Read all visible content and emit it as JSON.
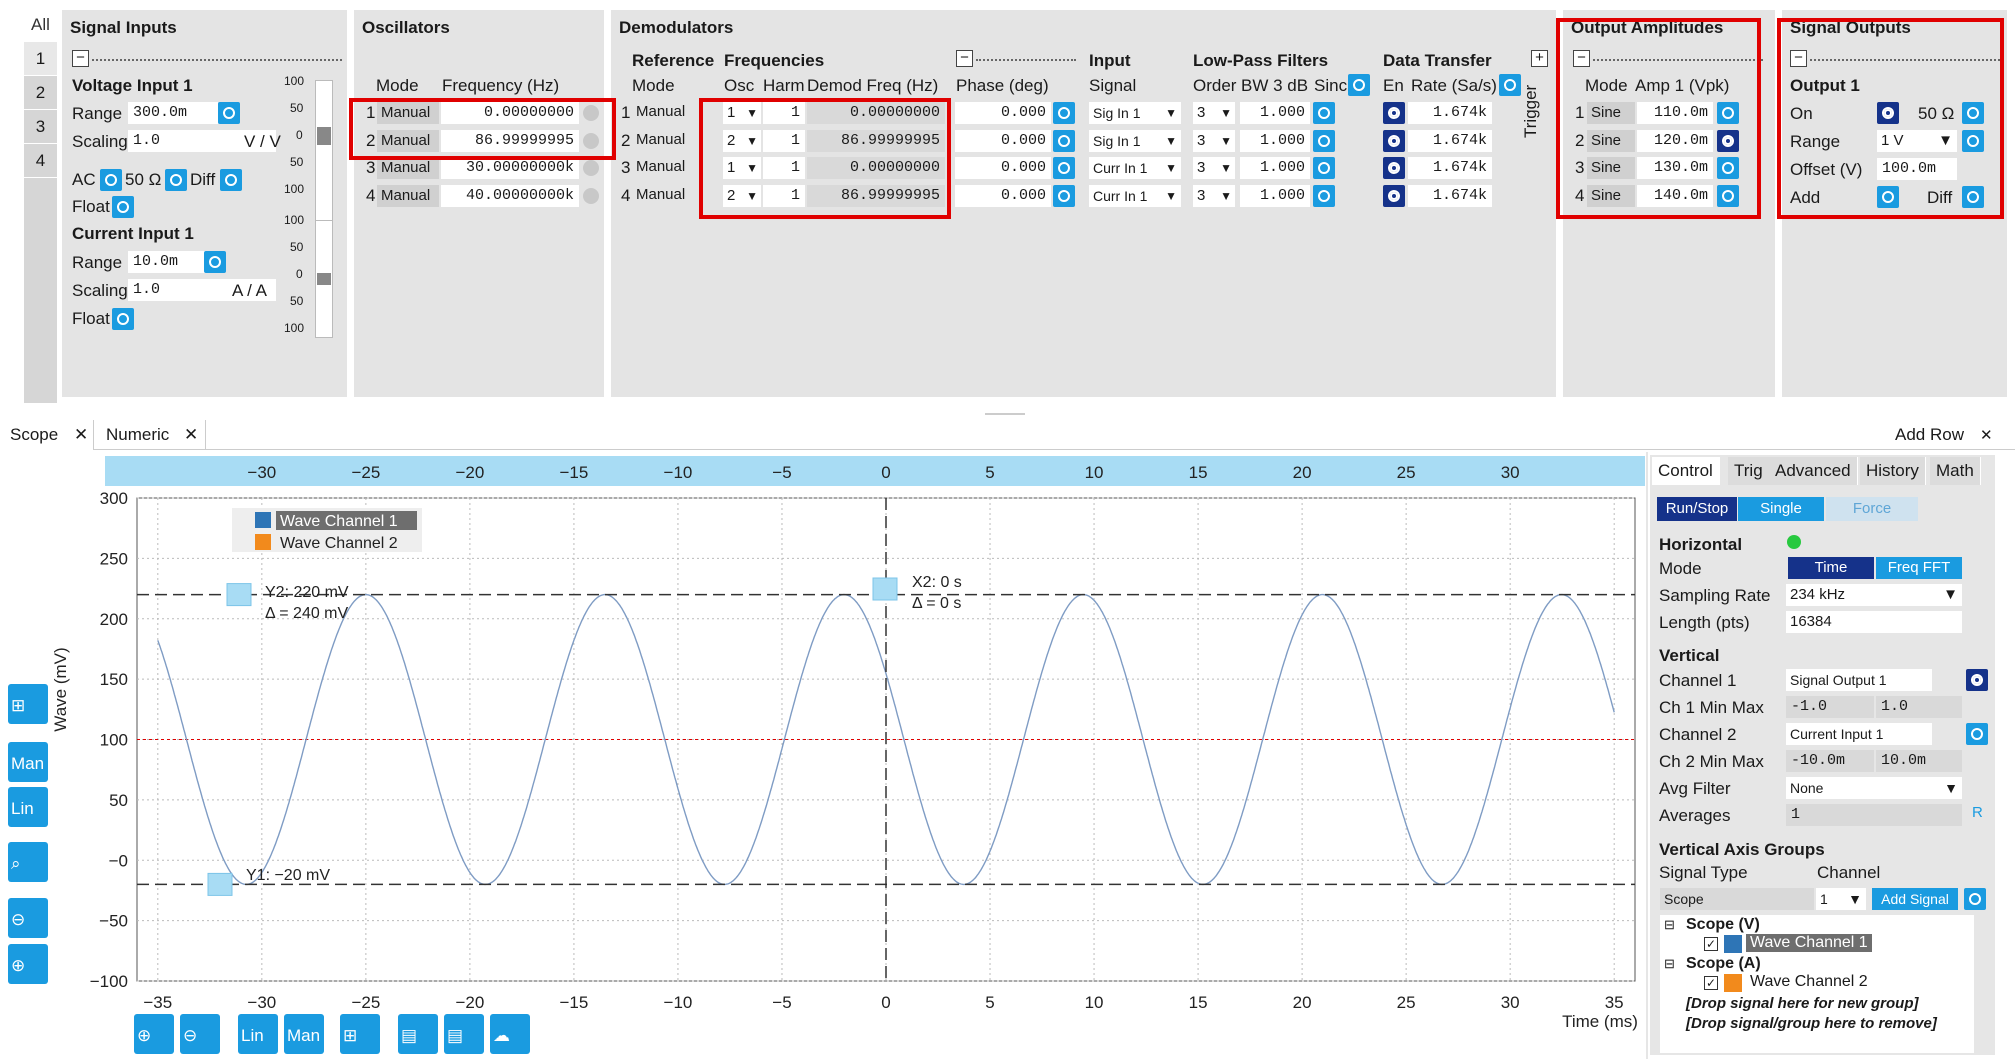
{
  "left_tabs": [
    "All",
    "1",
    "2",
    "3",
    "4"
  ],
  "signal_inputs": {
    "title": "Signal Inputs",
    "voltage_title": "Voltage Input 1",
    "range_label": "Range",
    "range_value": "300.0m",
    "scaling_label": "Scaling",
    "scaling_value": "1.0",
    "scaling_unit": "V / V",
    "ac_label": "AC",
    "ohm_label": "50 Ω",
    "diff_label": "Diff",
    "float_label": "Float",
    "current_title": "Current Input 1",
    "crange_label": "Range",
    "crange_value": "10.0m",
    "cscaling_label": "Scaling",
    "cscaling_value": "1.0",
    "cscaling_unit": "A / A",
    "cfloat_label": "Float",
    "meter_ticks_v": [
      "100",
      "50",
      "0",
      "50",
      "100"
    ],
    "meter_ticks_c": [
      "100",
      "50",
      "0",
      "50",
      "100"
    ]
  },
  "oscillators": {
    "title": "Oscillators",
    "col_mode": "Mode",
    "col_freq": "Frequency (Hz)",
    "rows": [
      {
        "n": "1",
        "mode": "Manual",
        "freq": "0.00000000"
      },
      {
        "n": "2",
        "mode": "Manual",
        "freq": "86.99999995"
      },
      {
        "n": "3",
        "mode": "Manual",
        "freq": "30.00000000k"
      },
      {
        "n": "4",
        "mode": "Manual",
        "freq": "40.00000000k"
      }
    ]
  },
  "demodulators": {
    "title": "Demodulators",
    "h_reference": "Reference",
    "h_frequencies": "Frequencies",
    "h_mode": "Mode",
    "h_osc": "Osc",
    "h_harm": "Harm",
    "h_demod": "Demod Freq (Hz)",
    "h_phase": "Phase (deg)",
    "h_input": "Input",
    "h_signal": "Signal",
    "h_lpf": "Low-Pass Filters",
    "h_order": "Order",
    "h_bw": "BW 3 dB",
    "h_sinc": "Sinc",
    "h_dt": "Data Transfer",
    "h_en": "En",
    "h_rate": "Rate (Sa/s)",
    "trigger_label": "Trigger",
    "rows": [
      {
        "n": "1",
        "mode": "Manual",
        "osc": "1",
        "harm": "1",
        "freq": "0.00000000",
        "phase": "0.000",
        "signal": "Sig In 1",
        "order": "3",
        "bw": "1.000",
        "rate": "1.674k"
      },
      {
        "n": "2",
        "mode": "Manual",
        "osc": "2",
        "harm": "1",
        "freq": "86.99999995",
        "phase": "0.000",
        "signal": "Sig In 1",
        "order": "3",
        "bw": "1.000",
        "rate": "1.674k"
      },
      {
        "n": "3",
        "mode": "Manual",
        "osc": "1",
        "harm": "1",
        "freq": "0.00000000",
        "phase": "0.000",
        "signal": "Curr In 1",
        "order": "3",
        "bw": "1.000",
        "rate": "1.674k"
      },
      {
        "n": "4",
        "mode": "Manual",
        "osc": "2",
        "harm": "1",
        "freq": "86.99999995",
        "phase": "0.000",
        "signal": "Curr In 1",
        "order": "3",
        "bw": "1.000",
        "rate": "1.674k"
      }
    ]
  },
  "output_amplitudes": {
    "title": "Output Amplitudes",
    "h_mode": "Mode",
    "h_amp": "Amp 1 (Vpk)",
    "rows": [
      {
        "n": "1",
        "mode": "Sine",
        "amp": "110.0m"
      },
      {
        "n": "2",
        "mode": "Sine",
        "amp": "120.0m"
      },
      {
        "n": "3",
        "mode": "Sine",
        "amp": "130.0m"
      },
      {
        "n": "4",
        "mode": "Sine",
        "amp": "140.0m"
      }
    ]
  },
  "signal_outputs": {
    "title": "Signal Outputs",
    "output_title": "Output 1",
    "on_label": "On",
    "ohm_label": "50 Ω",
    "range_label": "Range",
    "range_value": "1 V",
    "offset_label": "Offset (V)",
    "offset_value": "100.0m",
    "add_label": "Add",
    "diff_label": "Diff"
  },
  "tabs": {
    "scope": "Scope",
    "numeric": "Numeric",
    "add_row": "Add Row"
  },
  "scope": {
    "legend": [
      "Wave Channel 1",
      "Wave Channel 2"
    ],
    "ylabel": "Wave (mV)",
    "xlabel": "Time (ms)",
    "cursor_y2": "Y2: 220 mV",
    "cursor_y2_delta": "Δ = 240 mV",
    "cursor_y1": "Y1: −20 mV",
    "cursor_x2": "X2: 0 s",
    "cursor_x2_delta": "Δ = 0 s",
    "tools_left": [
      "Man",
      "Lin"
    ],
    "tools_bottom": [
      "Lin",
      "Man"
    ]
  },
  "chart_data": {
    "type": "line",
    "xlabel": "Time (ms)",
    "ylabel": "Wave (mV)",
    "xlim": [
      -36,
      36
    ],
    "ylim": [
      -100,
      300
    ],
    "x_ticks": [
      "−35",
      "−30",
      "−25",
      "−20",
      "−15",
      "−10",
      "−5",
      "0",
      "5",
      "10",
      "15",
      "20",
      "25",
      "30",
      "35"
    ],
    "x_ticks_top": [
      "−30",
      "−25",
      "−20",
      "−15",
      "−10",
      "−5",
      "0",
      "5",
      "10",
      "15",
      "20",
      "25",
      "30"
    ],
    "y_ticks": [
      "300",
      "250",
      "200",
      "150",
      "100",
      "50",
      "−0",
      "−50",
      "−100"
    ],
    "series": [
      {
        "name": "Wave Channel 1",
        "kind": "sine",
        "offset_mv": 100,
        "amplitude_mv": 120,
        "frequency_hz": 87,
        "x_start_ms": -35,
        "x_end_ms": 35
      }
    ],
    "cursors": {
      "y1_mv": -20,
      "y2_mv": 220,
      "x1_ms": 0,
      "x2_ms": 0
    },
    "grid": true,
    "legend_position": "top-left"
  },
  "control": {
    "tabs": [
      "Control",
      "Trig",
      "Advanced",
      "History",
      "Math"
    ],
    "run_stop": "Run/Stop",
    "single": "Single",
    "force": "Force",
    "horizontal": "Horizontal",
    "mode_label": "Mode",
    "mode_time": "Time",
    "mode_fft": "Freq FFT",
    "rate_label": "Sampling Rate",
    "rate_value": "234 kHz",
    "length_label": "Length (pts)",
    "length_value": "16384",
    "vertical": "Vertical",
    "ch1_label": "Channel 1",
    "ch1_value": "Signal Output 1",
    "ch1mm_label": "Ch 1 Min Max",
    "ch1_min": "-1.0",
    "ch1_max": "1.0",
    "ch2_label": "Channel 2",
    "ch2_value": "Current Input 1",
    "ch2mm_label": "Ch 2 Min Max",
    "ch2_min": "-10.0m",
    "ch2_max": "10.0m",
    "avg_label": "Avg Filter",
    "avg_value": "None",
    "averages_label": "Averages",
    "averages_value": "1",
    "r_label": "R",
    "vag": "Vertical Axis Groups",
    "sigtype_label": "Signal Type",
    "channel_label": "Channel",
    "sigtype_value": "Scope",
    "channel_value": "1",
    "add_signal": "Add Signal",
    "tree": {
      "g1": "Scope (V)",
      "g1_item": "Wave Channel 1",
      "g2": "Scope (A)",
      "g2_item": "Wave Channel 2",
      "drop1": "[Drop signal here for new group]",
      "drop2": "[Drop signal/group here to remove]"
    }
  },
  "colors": {
    "accent": "#1a9be0",
    "dark_accent": "#15328a",
    "highlight": "#e00000",
    "wave1": "#2e75b6",
    "wave2": "#f28a1c",
    "axis_bar": "#a8dcf4"
  }
}
